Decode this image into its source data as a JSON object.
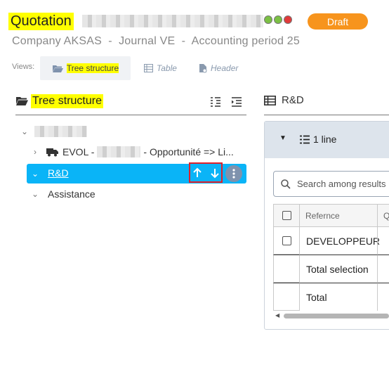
{
  "header": {
    "title": "Quotation",
    "status_badge": "Draft",
    "subtitle": "Company AKSAS  -  Journal VE  -  Accounting period 25",
    "status_dots": [
      "#7bc043",
      "#7bc043",
      "#e03a3a"
    ]
  },
  "views": {
    "label": "Views:",
    "tabs": [
      {
        "label": "Tree structure",
        "icon": "folder-open-icon",
        "active": true
      },
      {
        "label": "Table",
        "icon": "table-icon",
        "active": false
      },
      {
        "label": "Header",
        "icon": "document-icon",
        "active": false
      }
    ]
  },
  "tree_panel": {
    "title": "Tree structure",
    "items": [
      {
        "label": "",
        "expanded": true
      },
      {
        "label_prefix": "EVOL -",
        "label_suffix": "- Opportunité => Li...",
        "expanded": false
      },
      {
        "label": "R&D",
        "selected": true
      },
      {
        "label": "Assistance",
        "expanded": true
      }
    ]
  },
  "detail_panel": {
    "title": "R&D",
    "line_count": "1 line",
    "search_placeholder": "Search among results",
    "columns": [
      "Refernce",
      "Q"
    ],
    "rows": [
      {
        "label": "DEVELOPPEUR",
        "checkbox": true
      },
      {
        "label": "Total selection",
        "checkbox": false
      },
      {
        "label": "Total",
        "checkbox": false
      }
    ]
  },
  "colors": {
    "accent": "#0ab4f7",
    "badge": "#f7941d",
    "highlight": "#ffff00",
    "focus_outline": "#e0202a"
  }
}
